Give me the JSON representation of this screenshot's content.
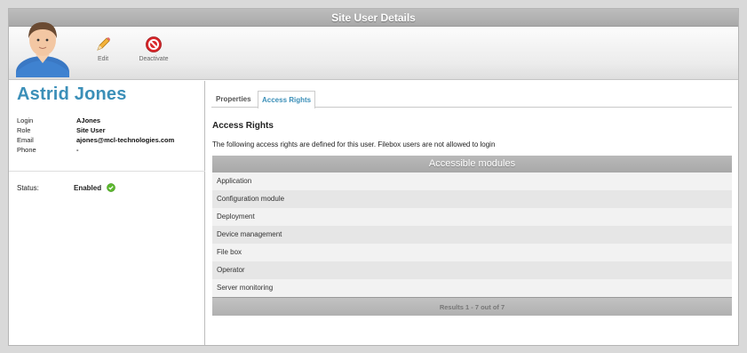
{
  "window": {
    "title": "Site User Details"
  },
  "toolbar": {
    "edit_label": "Edit",
    "deactivate_label": "Deactivate"
  },
  "user": {
    "name": "Astrid Jones",
    "fields": [
      {
        "label": "Login",
        "value": "AJones"
      },
      {
        "label": "Role",
        "value": "Site User"
      },
      {
        "label": "Email",
        "value": "ajones@mcl-technologies.com"
      },
      {
        "label": "Phone",
        "value": "-"
      }
    ],
    "status_label": "Status:",
    "status_value": "Enabled"
  },
  "tabs": [
    {
      "label": "Properties",
      "active": false
    },
    {
      "label": "Access Rights",
      "active": true
    }
  ],
  "section": {
    "title": "Access Rights",
    "description": "The following access rights are defined for this user. Filebox users are not allowed to login"
  },
  "modules_table": {
    "header": "Accessible modules",
    "rows": [
      "Application",
      "Configuration module",
      "Deployment",
      "Device management",
      "File box",
      "Operator",
      "Server monitoring"
    ],
    "footer": "Results 1 - 7 out of 7"
  },
  "colors": {
    "accent": "#3b8fb8",
    "status_ok": "#5cb82e",
    "deactivate": "#d9262a"
  }
}
